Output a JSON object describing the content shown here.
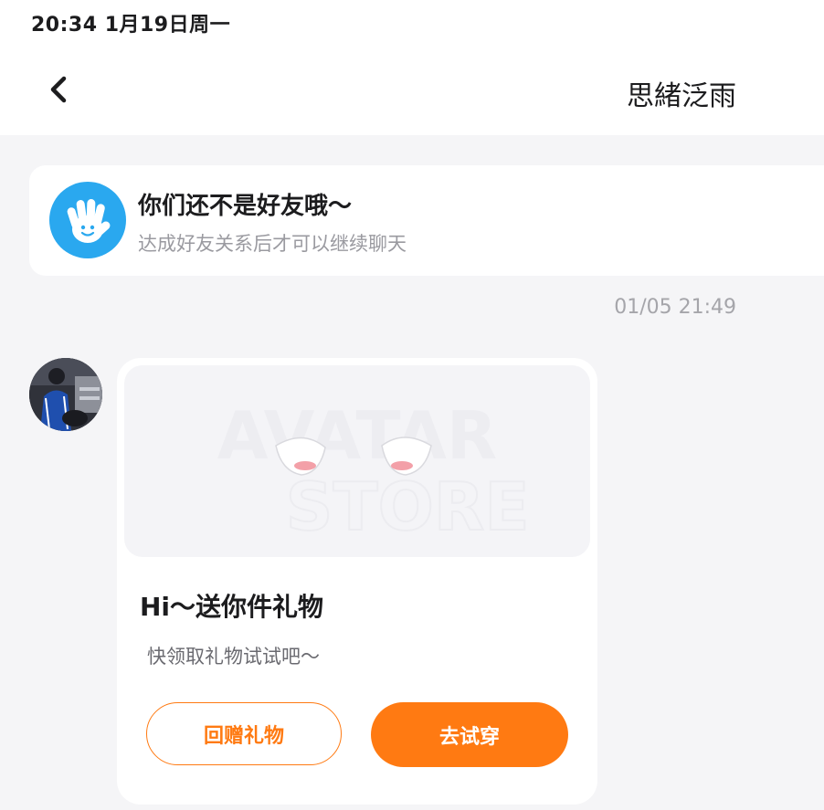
{
  "status_bar": {
    "time_date": "20:34   1月19日周一"
  },
  "nav": {
    "back_icon": "chevron-left-icon",
    "title": "思緒泛雨"
  },
  "notice": {
    "icon": "waving-hand-icon",
    "icon_color": "#2aa8ef",
    "title": "你们还不是好友哦～",
    "subtitle": "达成好友关系后才可以继续聊天"
  },
  "message": {
    "timestamp": "01/05 21:49",
    "gift_card": {
      "title": "Hi～送你件礼物",
      "subtitle": "快领取礼物试试吧～",
      "return_gift_label": "回赠礼物",
      "try_on_label": "去试穿",
      "accent_color": "#ff7a12"
    }
  }
}
